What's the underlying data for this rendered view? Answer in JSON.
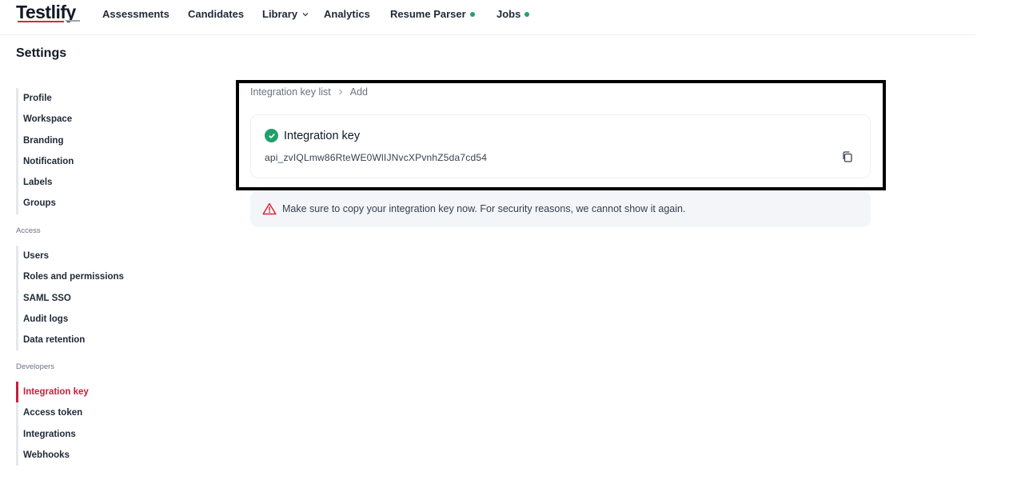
{
  "brand": {
    "name": "Testlify"
  },
  "nav": {
    "items": [
      {
        "label": "Assessments"
      },
      {
        "label": "Candidates"
      },
      {
        "label": "Library"
      },
      {
        "label": "Analytics"
      },
      {
        "label": "Resume Parser"
      },
      {
        "label": "Jobs"
      }
    ]
  },
  "page": {
    "title": "Settings"
  },
  "sidebar": {
    "general": [
      "Profile",
      "Workspace",
      "Branding",
      "Notification",
      "Labels",
      "Groups"
    ],
    "access_heading": "Access",
    "access": [
      "Users",
      "Roles and permissions",
      "SAML SSO",
      "Audit logs",
      "Data retention"
    ],
    "developers_heading": "Developers",
    "developers": [
      "Integration key",
      "Access token",
      "Integrations",
      "Webhooks"
    ]
  },
  "breadcrumb": {
    "parent": "Integration key list",
    "current": "Add"
  },
  "key_card": {
    "title": "Integration key",
    "value": "api_zvIQLmw86RteWE0WlIJNvcXPvnhZ5da7cd54"
  },
  "warning": {
    "text": "Make sure to copy your integration key now. For security reasons, we cannot show it again."
  },
  "colors": {
    "accent": "#c81e3a",
    "success": "#22a06b",
    "warning": "#d62839"
  }
}
